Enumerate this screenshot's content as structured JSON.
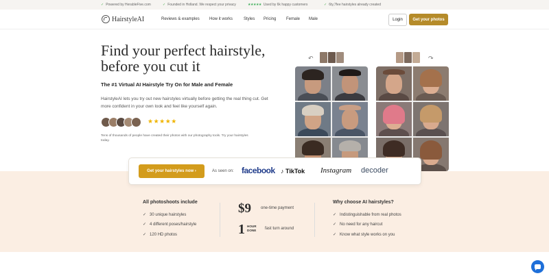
{
  "topbar": {
    "items": [
      "Powered by HerableFive.com",
      "Founded in Holland. We respect your privacy",
      "Used by 6k happy customers",
      "6ty,7fee hairstyles already created"
    ]
  },
  "nav": {
    "logo": "HairstyleAI",
    "links": [
      "Reviews & examples",
      "How it works",
      "Styles",
      "Pricing",
      "Female",
      "Male"
    ],
    "login": "Login",
    "get_photos": "Get your photos"
  },
  "hero": {
    "title_line1": "Find your perfect hairstyle,",
    "title_line2": "before you cut it",
    "subtitle": "The #1 Virtual AI Hairstyle Try On for Male and Female",
    "description": "HairstyleAI lets you try out new hairstyles virtually before getting the real thing cut. Get more confident in your own look and feel like yourself again.",
    "stars": "★★★★★",
    "note": "Tens of thousands of people have created their photos with our photography tools. Try your hairstyles today."
  },
  "seen": {
    "cta": "Get your hairstyles now ›",
    "label": "As seen on:",
    "brands": [
      "facebook",
      "TikTok",
      "Instagram",
      "decoder"
    ]
  },
  "package": {
    "title": "All photoshoots include",
    "items": [
      "30 unique hairstyles",
      "4 different poses/hairstyle",
      "120 HD photos"
    ],
    "price": "$9",
    "price_note": "one-time payment",
    "hour_num": "1",
    "hour_label_1": "HOUR",
    "hour_label_2": "DONE",
    "hour_note": "fast turn around"
  },
  "why": {
    "title": "Why choose AI hairstyles?",
    "items": [
      "Indistinguishable from real photos",
      "No need for any haircut",
      "Know what style works on you"
    ]
  },
  "colors": {
    "accent": "#d39c1c",
    "accent_dark": "#b58b2a",
    "peach_bg": "#fbeee3",
    "chat": "#1e6fd9"
  }
}
